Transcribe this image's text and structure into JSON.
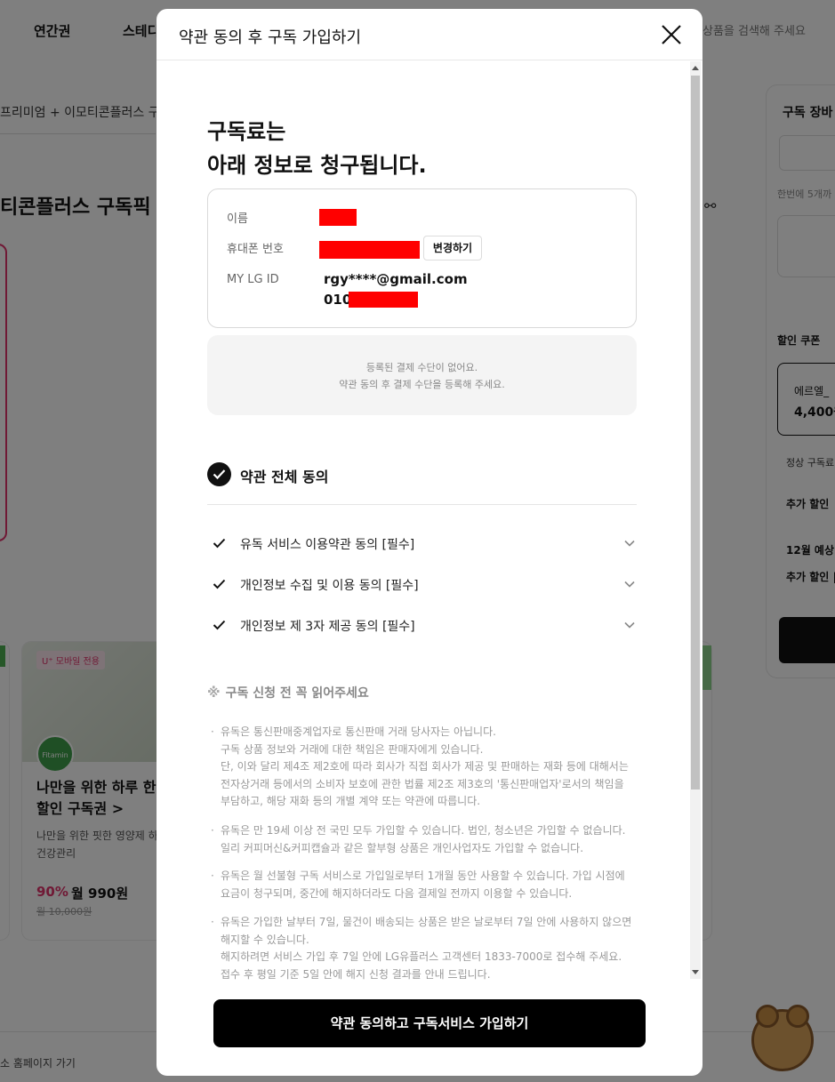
{
  "background": {
    "nav": [
      "연간권",
      "스테디"
    ],
    "search_placeholder": "상품을 검색해 주세요",
    "breadcrumb": "프리미엄 + 이모티콘플러스 구",
    "page_title": "티콘플러스 구독픽",
    "card": {
      "badge": "U⁺ 모바일 전용",
      "logo": "Fitamin",
      "title": "나만을 위한 하루 한 할인 구독권 >",
      "desc": "나만을 위한 핏한 영양제 하 건강관리",
      "discount": "90%",
      "price": "월 990원",
      "original_price": "월 10,000원"
    },
    "side_panel": {
      "title": "구독 장바",
      "hint": "한번에 5개까",
      "coupon_title": "할인 쿠폰",
      "coupon_name": "에르엘_",
      "coupon_amount": "4,400원",
      "regular": "정상 구독료",
      "extra_discount": "추가 할인",
      "december": "12월 예상",
      "extra_discount2": "추가 할인 |"
    },
    "footer_link": "소 홈페이지 가기"
  },
  "modal": {
    "title": "약관 동의 후 구독 가입하기",
    "headline_line1": "구독료는",
    "headline_line2": "아래 정보로 청구됩니다.",
    "info": {
      "name_label": "이름",
      "phone_label": "휴대폰 번호",
      "change_button": "변경하기",
      "lgid_label": "MY LG ID",
      "lgid_email": "rgy****@gmail.com",
      "lgid_phone_prefix": "010"
    },
    "payment_notice_line1": "등록된 결제 수단이 없어요.",
    "payment_notice_line2": "약관 동의 후 결제 수단을 등록해 주세요.",
    "agree_all": "약관 전체 동의",
    "terms": [
      "유독 서비스 이용약관 동의 [필수]",
      "개인정보 수집 및 이용 동의 [필수]",
      "개인정보 제 3자 제공 동의 [필수]"
    ],
    "notice_mark": "※",
    "notice_title": "구독 신청 전 꼭 읽어주세요",
    "notices": [
      {
        "bullet": "·",
        "lines": [
          "유독은 통신판매중계업자로 통신판매 거래 당사자는 아닙니다.",
          "구독 상품 정보와 거래에 대한 책임은 판매자에게 있습니다.",
          "단, 이와 달리 제4조 제2호에 따라 회사가 직접 회사가 제공 및 판매하는 재화 등에 대해서는",
          "전자상거래 등에서의 소비자 보호에 관한 법률 제2조 제3호의 '통신판매업자'로서의 책임을",
          "부담하고, 해당 재화 등의 개별 계약 또는 약관에 따릅니다."
        ]
      },
      {
        "bullet": "·",
        "lines": [
          "유독은 만 19세 이상 전 국민 모두 가입할 수 있습니다. 법인, 청소년은 가입할 수 없습니다.",
          "일리 커피머신&커피캡슐과 같은 할부형 상품은 개인사업자도 가입할 수 없습니다."
        ]
      },
      {
        "bullet": "·",
        "lines": [
          "유독은 월 선불형 구독 서비스로 가입일로부터 1개월 동안 사용할 수 있습니다. 가입 시점에",
          "요금이 청구되며, 중간에 해지하더라도 다음 결제일 전까지 이용할 수 있습니다."
        ]
      },
      {
        "bullet": "·",
        "lines": [
          "유독은 가입한 날부터 7일, 물건이 배송되는 상품은 받은 날로부터 7일 안에 사용하지 않으면",
          "해지할 수 있습니다.",
          "해지하려면 서비스 가입 후 7일 안에 LG유플러스 고객센터 1833-7000로 접수해 주세요.",
          "접수 후 평일 기준 5일 안에 해지 신청 결과를 안내 드립니다."
        ]
      }
    ],
    "submit_button": "약관 동의하고 구독서비스 가입하기"
  }
}
